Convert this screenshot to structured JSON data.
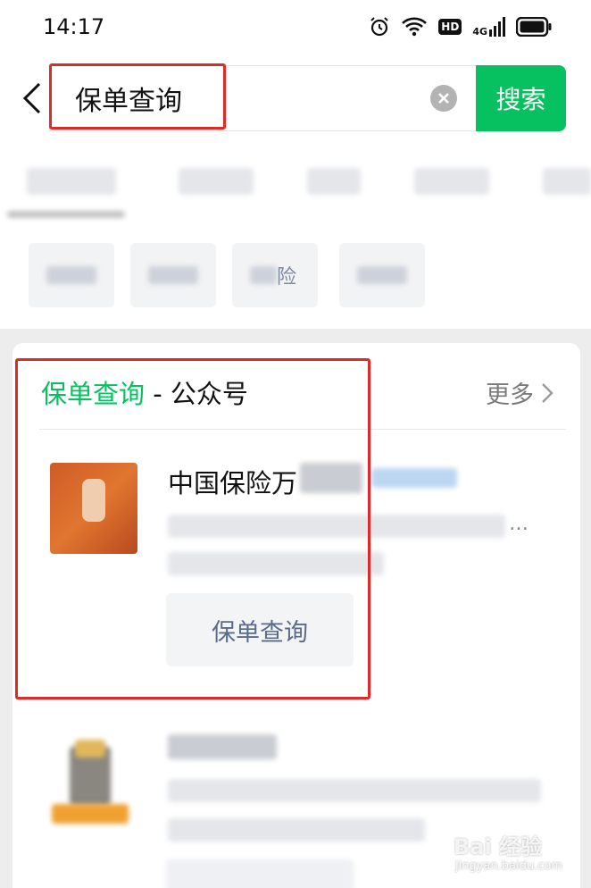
{
  "status_bar": {
    "time": "14:17",
    "icons": [
      "alarm-icon",
      "wifi-icon",
      "hd-icon",
      "4g-signal-icon",
      "battery-icon"
    ],
    "hd_label": "HD",
    "network_label": "4G"
  },
  "search": {
    "query": "保单查询",
    "submit_label": "搜索",
    "accent_color": "#07c160"
  },
  "result_card": {
    "title_keyword": "保单查询",
    "title_separator": " - ",
    "title_category": "公众号",
    "more_label": "更多",
    "items": [
      {
        "name": "中国保险万",
        "service_button": "保单查询"
      }
    ]
  },
  "filters": {
    "partially_visible_chip_text": "险"
  },
  "annotations": {
    "highlight_color": "#e02a2a"
  },
  "watermark": {
    "brand": "Bai 经验",
    "url": "jingyan.baidu.com"
  }
}
